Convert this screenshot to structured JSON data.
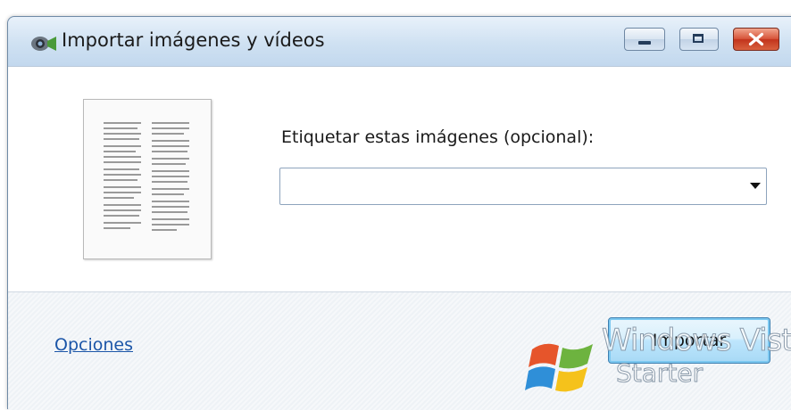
{
  "window": {
    "title": "Importar imágenes y vídeos",
    "icon": "camera-import-icon",
    "controls": {
      "minimize": "minimize-icon",
      "maximize": "maximize-icon",
      "close": "close-icon"
    }
  },
  "main": {
    "tag_label": "Etiquetar estas imágenes (opcional):",
    "tag_combo": {
      "value": "",
      "placeholder": ""
    }
  },
  "footer": {
    "options_link": "Opciones",
    "import_button": "Importar"
  },
  "watermark": {
    "line1": "Windows Vist",
    "line2": "Starter"
  },
  "colors": {
    "link": "#1c56a8",
    "close_button": "#c2341c",
    "button_highlight": "#7cc8f0"
  }
}
